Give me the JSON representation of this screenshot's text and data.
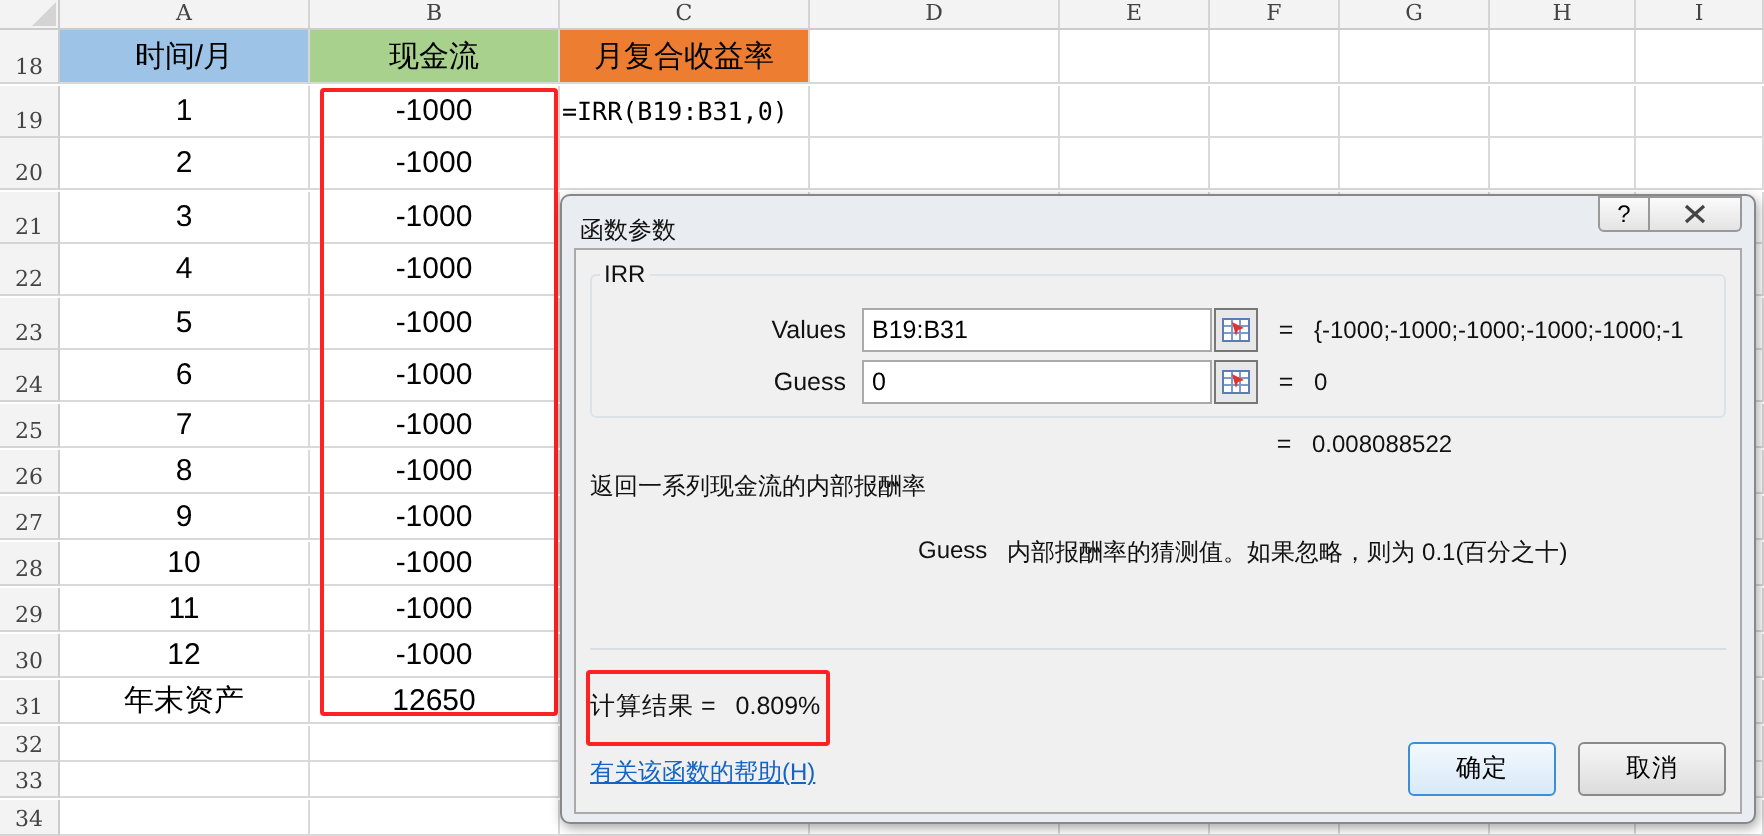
{
  "columns": [
    "A",
    "B",
    "C",
    "D",
    "E",
    "F",
    "G",
    "H",
    "I"
  ],
  "header_row": {
    "row": "18",
    "cells": [
      {
        "text": "时间/月",
        "color": "#9dc3e6"
      },
      {
        "text": "现金流",
        "color": "#a9d18e"
      },
      {
        "text": "月复合收益率",
        "color": "#ed7d31"
      }
    ]
  },
  "rows": [
    {
      "row": "19",
      "month": "1",
      "cash_flow": "-1000",
      "formula": "=IRR(B19:B31,0)"
    },
    {
      "row": "20",
      "month": "2",
      "cash_flow": "-1000"
    },
    {
      "row": "21",
      "month": "3",
      "cash_flow": "-1000"
    },
    {
      "row": "22",
      "month": "4",
      "cash_flow": "-1000"
    },
    {
      "row": "23",
      "month": "5",
      "cash_flow": "-1000"
    },
    {
      "row": "24",
      "month": "6",
      "cash_flow": "-1000"
    },
    {
      "row": "25",
      "month": "7",
      "cash_flow": "-1000"
    },
    {
      "row": "26",
      "month": "8",
      "cash_flow": "-1000"
    },
    {
      "row": "27",
      "month": "9",
      "cash_flow": "-1000"
    },
    {
      "row": "28",
      "month": "10",
      "cash_flow": "-1000"
    },
    {
      "row": "29",
      "month": "11",
      "cash_flow": "-1000"
    },
    {
      "row": "30",
      "month": "12",
      "cash_flow": "-1000"
    },
    {
      "row": "31",
      "month": "年末资产",
      "cash_flow": "12650"
    },
    {
      "row": "32"
    },
    {
      "row": "33"
    },
    {
      "row": "34"
    }
  ],
  "dialog": {
    "title": "函数参数",
    "help_button": "?",
    "group": "IRR",
    "arguments": [
      {
        "label": "Values",
        "value": "B19:B31",
        "equals": "=",
        "result": "{-1000;-1000;-1000;-1000;-1000;-1"
      },
      {
        "label": "Guess",
        "value": "0",
        "equals": "=",
        "result": "0"
      }
    ],
    "formula_equals": "=",
    "formula_result": "0.008088522",
    "description": "返回一系列现金流的内部报酬率",
    "argument_help": {
      "name": "Guess",
      "text": "内部报酬率的猜测值。如果忽略，则为 0.1(百分之十)"
    },
    "result_label": "计算结果 =",
    "result_value": "0.809%",
    "help_link": "有关该函数的帮助(H)",
    "buttons": [
      {
        "label": "确定",
        "default": true
      },
      {
        "label": "取消",
        "default": false
      }
    ]
  }
}
